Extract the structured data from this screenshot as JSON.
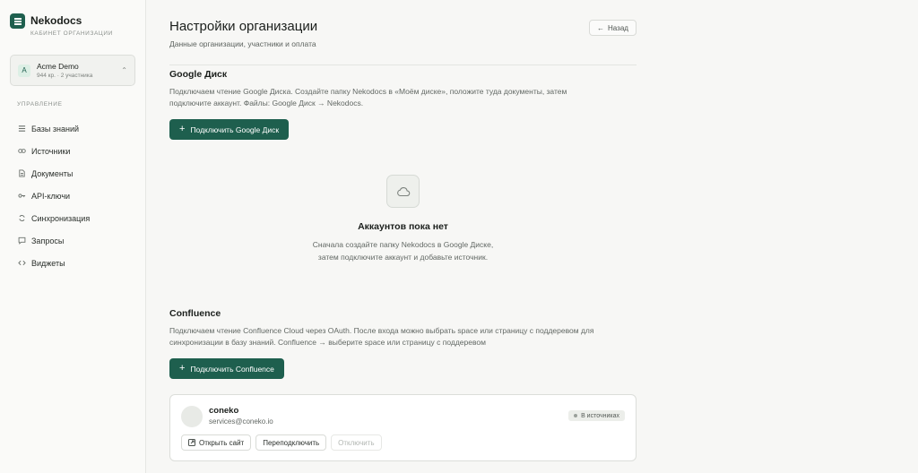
{
  "sidebar": {
    "brand_name": "Nekodocs",
    "brand_sub": "КАБИНЕТ ОРГАНИЗАЦИИ",
    "org": {
      "avatar": "A",
      "name": "Acme Demo",
      "meta": "944 кр. · 2 участника"
    },
    "section_label": "УПРАВЛЕНИЕ",
    "items": [
      {
        "label": "Базы знаний",
        "icon": "list-icon"
      },
      {
        "label": "Источники",
        "icon": "link-icon"
      },
      {
        "label": "Документы",
        "icon": "document-icon"
      },
      {
        "label": "API-ключи",
        "icon": "key-icon"
      },
      {
        "label": "Синхронизация",
        "icon": "sync-icon"
      },
      {
        "label": "Запросы",
        "icon": "chat-icon"
      },
      {
        "label": "Виджеты",
        "icon": "code-icon"
      }
    ]
  },
  "header": {
    "title": "Настройки организации",
    "subtitle": "Данные организации, участники и оплата",
    "back_label": "Назад"
  },
  "google": {
    "title": "Google Диск",
    "desc_line1": "Подключаем чтение Google Диска. Создайте папку Nekodocs в «Моём диске», положите туда документы, затем",
    "desc_line2": "подключите аккаунт. Файлы: Google Диск → Nekodocs.",
    "button": "Подключить Google Диск",
    "empty_title": "Аккаунтов пока нет",
    "empty_line1": "Сначала создайте папку Nekodocs в Google Диске,",
    "empty_line2": "затем подключите аккаунт и добавьте источник."
  },
  "confluence": {
    "title": "Confluence",
    "desc_line1": "Подключаем чтение Confluence Cloud через OAuth. После входа можно выбрать space или страницу с поддеревом для",
    "desc_line2": "синхронизации в базу знаний. Confluence → выберите space или страницу с поддеревом",
    "button": "Подключить Confluence",
    "account": {
      "name": "coneko",
      "email": "services@coneko.io",
      "badge": "В источниках",
      "open_site": "Открыть сайт",
      "reconnect": "Переподключить",
      "disconnect": "Отключить"
    }
  },
  "colors": {
    "accent": "#1e5f4e",
    "background": "#f7f7f5",
    "sidebar": "#fafaf8"
  }
}
